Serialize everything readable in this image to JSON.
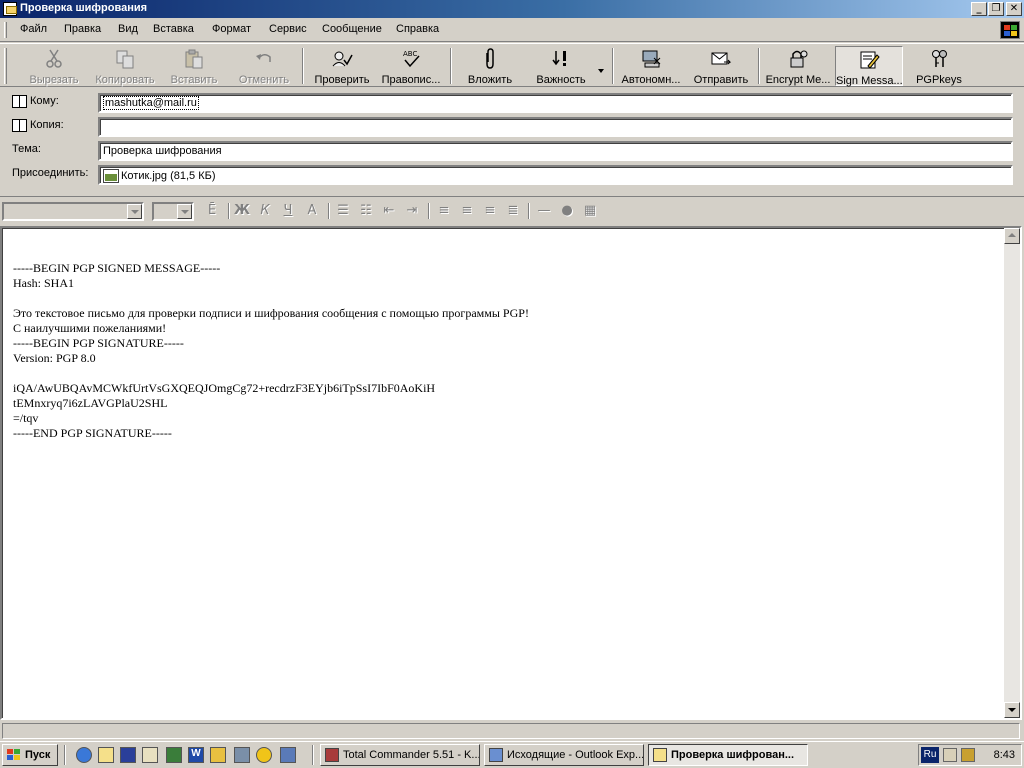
{
  "window": {
    "title": "Проверка шифрования"
  },
  "menu": [
    {
      "label": "Файл"
    },
    {
      "label": "Правка"
    },
    {
      "label": "Вид"
    },
    {
      "label": "Вставка"
    },
    {
      "label": "Формат"
    },
    {
      "label": "Сервис"
    },
    {
      "label": "Сообщение"
    },
    {
      "label": "Справка"
    }
  ],
  "toolbar": {
    "cut": "Вырезать",
    "copy": "Копировать",
    "paste": "Вставить",
    "undo": "Отменить",
    "check": "Проверить",
    "spelling": "Правопис...",
    "attach": "Вложить",
    "priority": "Важность",
    "offline": "Автономн...",
    "send": "Отправить",
    "encrypt": "Encrypt Me...",
    "sign": "Sign Messa...",
    "pgpkeys": "PGPkeys"
  },
  "fields": {
    "to_label": "Кому:",
    "to_value": "mashutka@mail.ru",
    "cc_label": "Копия:",
    "cc_value": "",
    "subject_label": "Тема:",
    "subject_value": "Проверка шифрования",
    "attach_label": "Присоединить:",
    "attach_value": "Котик.jpg (81,5 КБ)"
  },
  "format_bar": {
    "bold": "Ж",
    "italic": "К",
    "underline": "Ч"
  },
  "body": {
    "text": "-----BEGIN PGP SIGNED MESSAGE-----\nHash: SHA1\n\nЭто текстовое письмо для проверки подписи и шифрования сообщения с помощью программы PGP!\nС наилучшими пожеланиями!\n-----BEGIN PGP SIGNATURE-----\nVersion: PGP 8.0\n\niQA/AwUBQAvMCWkfUrtVsGXQEQJOmgCg72+recdrzF3EYjb6iTpSsI7IbF0AoKiH\ntEMnxryq7i6zLAVGPlaU2SHL\n=/tqv\n-----END PGP SIGNATURE-----"
  },
  "taskbar": {
    "start": "Пуск",
    "tasks": [
      {
        "label": "Total Commander 5.51 - K..."
      },
      {
        "label": "Исходящие - Outlook Exp..."
      },
      {
        "label": "Проверка шифрован..."
      }
    ],
    "lang": "Ru",
    "clock": "8:43"
  }
}
